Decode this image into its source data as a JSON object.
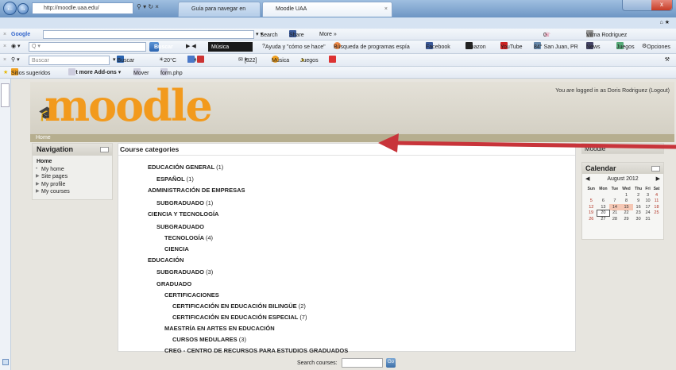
{
  "browser": {
    "url": "http://moodle.uaa.edu/",
    "tabs": [
      {
        "label": "Guía para navegar en Moodle ..."
      },
      {
        "label": "Moodle UAA"
      }
    ],
    "google_toolbar": {
      "brand": "Google",
      "search_label": "Search",
      "share_label": "Share",
      "more_label": "More »",
      "user_label": "Vilma Rodriguez",
      "counter": "0"
    },
    "toolbar2": {
      "search_button": "Buscar",
      "music_label": "Música",
      "help_label": "Ayuda y \"cómo se hace\"",
      "spy_label": "Búsqueda de programas espía",
      "facebook_label": "Facebook",
      "amazon_label": "Amazon",
      "youtube_label": "YouTube",
      "weather_label": "84° San Juan, PR",
      "news_label": "News",
      "games_label": "Juegos",
      "options_label": "Opciones"
    },
    "toolbar3": {
      "search_placeholder": "Buscar",
      "buscar_label": "Buscar",
      "temp_label": "20°C",
      "mail_count": "[322]",
      "music_label": "Música",
      "games_label": "Juegos"
    },
    "bookmarks": {
      "suggested": "Sitios sugeridos",
      "addons": "Get more Add-ons",
      "mover": "Mover",
      "form": "form.php"
    }
  },
  "moodle": {
    "logo_text": "moodle",
    "logged_in": "You are logged in as Doris Rodriguez (Logout)",
    "home_crumb": "Home",
    "navigation": {
      "title": "Navigation",
      "home": "Home",
      "items": [
        "My home",
        "Site pages",
        "My profile",
        "My courses"
      ]
    },
    "course_categories": {
      "title": "Course categories",
      "items": [
        {
          "name": "EDUCACIÓN GENERAL",
          "count": "(1)"
        },
        {
          "name": "ESPAÑOL",
          "count": "(1)"
        },
        {
          "name": "ADMINISTRACIÓN DE EMPRESAS",
          "count": ""
        },
        {
          "name": "SUBGRADUADO",
          "count": "(1)"
        },
        {
          "name": "CIENCIA Y TECNOLOGÍA",
          "count": ""
        },
        {
          "name": "SUBGRADUADO",
          "count": ""
        },
        {
          "name": "TECNOLOGÍA",
          "count": "(4)"
        },
        {
          "name": "CIENCIA",
          "count": ""
        },
        {
          "name": "EDUCACIÓN",
          "count": ""
        },
        {
          "name": "SUBGRADUADO",
          "count": "(3)"
        },
        {
          "name": "GRADUADO",
          "count": ""
        },
        {
          "name": "CERTIFICACIONES",
          "count": ""
        },
        {
          "name": "CERTIFICACIÓN EN EDUCACIÓN BILINGÜE",
          "count": "(2)"
        },
        {
          "name": "CERTIFICACIÓN EN EDUCACIÓN ESPECIAL",
          "count": "(7)"
        },
        {
          "name": "MAESTRÍA EN ARTES EN EDUCACIÓN",
          "count": ""
        },
        {
          "name": "CURSOS MEDULARES",
          "count": "(3)"
        },
        {
          "name": "CREG - CENTRO DE RECURSOS PARA ESTUDIOS GRADUADOS",
          "count": ""
        }
      ]
    },
    "right_block_label": "Moodle",
    "calendar": {
      "title": "Calendar",
      "month": "August 2012",
      "weekdays": [
        "Sun",
        "Mon",
        "Tue",
        "Wed",
        "Thu",
        "Fri",
        "Sat"
      ],
      "weeks": [
        [
          "",
          "",
          "",
          "1",
          "2",
          "3",
          "4"
        ],
        [
          "5",
          "6",
          "7",
          "8",
          "9",
          "10",
          "11"
        ],
        [
          "12",
          "13",
          "14",
          "15",
          "16",
          "17",
          "18"
        ],
        [
          "19",
          "20",
          "21",
          "22",
          "23",
          "24",
          "25"
        ],
        [
          "26",
          "27",
          "28",
          "29",
          "30",
          "31",
          ""
        ]
      ],
      "today": "20",
      "event_days": [
        "14",
        "15"
      ]
    },
    "search": {
      "label": "Search courses:",
      "go": "Go"
    }
  }
}
